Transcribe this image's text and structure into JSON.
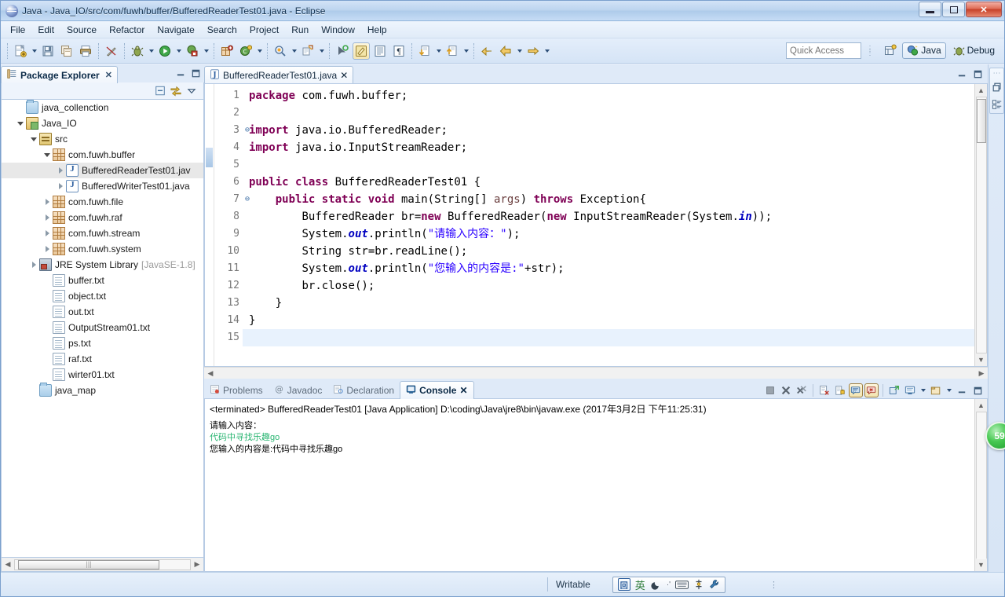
{
  "window": {
    "title": "Java - Java_IO/src/com/fuwh/buffer/BufferedReaderTest01.java - Eclipse",
    "app_icon": "eclipse-icon",
    "minimize_label": "",
    "maximize_label": "",
    "close_label": "✕"
  },
  "menubar": {
    "items": [
      {
        "label": "File"
      },
      {
        "label": "Edit"
      },
      {
        "label": "Source"
      },
      {
        "label": "Refactor"
      },
      {
        "label": "Navigate"
      },
      {
        "label": "Search"
      },
      {
        "label": "Project"
      },
      {
        "label": "Run"
      },
      {
        "label": "Window"
      },
      {
        "label": "Help"
      }
    ]
  },
  "toolbar": {
    "quick_access_placeholder": "Quick Access",
    "quick_access_value": "",
    "buttons": [
      {
        "name": "new-wizard-icon",
        "glyph": "📄"
      },
      {
        "name": "save-icon",
        "glyph": "💾"
      },
      {
        "name": "save-all-icon",
        "glyph": "🗇"
      },
      {
        "name": "print-icon",
        "glyph": "🖨"
      },
      {
        "name": "toggle-mark-occurrences-icon",
        "glyph": "✎"
      },
      {
        "name": "debug-icon",
        "glyph": "🐞"
      },
      {
        "name": "run-icon",
        "glyph": "▶"
      },
      {
        "name": "external-tools-icon",
        "glyph": "🧰"
      },
      {
        "name": "new-java-package-icon",
        "glyph": "📦"
      },
      {
        "name": "new-java-class-icon",
        "glyph": "Ⓒ"
      },
      {
        "name": "open-type-icon",
        "glyph": "🔍"
      },
      {
        "name": "search-icon",
        "glyph": "🔎"
      },
      {
        "name": "next-annotation-icon",
        "glyph": "➤"
      },
      {
        "name": "toggle-block-selection-icon",
        "glyph": "✏"
      },
      {
        "name": "show-whitespace-icon",
        "glyph": "▤"
      },
      {
        "name": "toggle-mark-icon",
        "glyph": "¶"
      },
      {
        "name": "previous-edit-icon",
        "glyph": "↧"
      },
      {
        "name": "next-edit-icon",
        "glyph": "↥"
      },
      {
        "name": "back-icon",
        "glyph": "⬅"
      },
      {
        "name": "forward-icon",
        "glyph": "➡"
      }
    ],
    "perspective_open_label": "",
    "perspectives": [
      {
        "label": "Java",
        "active": true
      },
      {
        "label": "Debug",
        "active": false
      }
    ]
  },
  "package_explorer": {
    "tab_label": "Package Explorer",
    "tab_close": "✕",
    "collapse_all_label": "",
    "link_with_editor_label": "",
    "view_menu_label": "",
    "tree": [
      {
        "indent": 1,
        "twisty": "none",
        "icon": "folder",
        "label": "java_collenction",
        "selected": false
      },
      {
        "indent": 1,
        "twisty": "expanded",
        "icon": "project",
        "label": "Java_IO",
        "selected": false
      },
      {
        "indent": 2,
        "twisty": "expanded",
        "icon": "src",
        "label": "src",
        "selected": false
      },
      {
        "indent": 3,
        "twisty": "expanded",
        "icon": "package",
        "label": "com.fuwh.buffer",
        "selected": false
      },
      {
        "indent": 4,
        "twisty": "collapsed",
        "icon": "java",
        "label": "BufferedReaderTest01.jav",
        "selected": true
      },
      {
        "indent": 4,
        "twisty": "collapsed",
        "icon": "java",
        "label": "BufferedWriterTest01.java",
        "selected": false
      },
      {
        "indent": 3,
        "twisty": "collapsed",
        "icon": "package",
        "label": "com.fuwh.file",
        "selected": false
      },
      {
        "indent": 3,
        "twisty": "collapsed",
        "icon": "package",
        "label": "com.fuwh.raf",
        "selected": false
      },
      {
        "indent": 3,
        "twisty": "collapsed",
        "icon": "package",
        "label": "com.fuwh.stream",
        "selected": false
      },
      {
        "indent": 3,
        "twisty": "collapsed",
        "icon": "package",
        "label": "com.fuwh.system",
        "selected": false
      },
      {
        "indent": 2,
        "twisty": "collapsed",
        "icon": "jre",
        "label": "JRE System Library",
        "suffix": "[JavaSE-1.8]",
        "selected": false
      },
      {
        "indent": 3,
        "twisty": "none",
        "icon": "file",
        "label": "buffer.txt",
        "selected": false
      },
      {
        "indent": 3,
        "twisty": "none",
        "icon": "file",
        "label": "object.txt",
        "selected": false
      },
      {
        "indent": 3,
        "twisty": "none",
        "icon": "file",
        "label": "out.txt",
        "selected": false
      },
      {
        "indent": 3,
        "twisty": "none",
        "icon": "file",
        "label": "OutputStream01.txt",
        "selected": false
      },
      {
        "indent": 3,
        "twisty": "none",
        "icon": "file",
        "label": "ps.txt",
        "selected": false
      },
      {
        "indent": 3,
        "twisty": "none",
        "icon": "file",
        "label": "raf.txt",
        "selected": false
      },
      {
        "indent": 3,
        "twisty": "none",
        "icon": "file",
        "label": "wirter01.txt",
        "selected": false
      },
      {
        "indent": 2,
        "twisty": "none",
        "icon": "folder",
        "label": "java_map",
        "selected": false
      }
    ]
  },
  "editor": {
    "tab_label": "BufferedReaderTest01.java",
    "tab_close": "✕",
    "tab_icon": "java-file-icon",
    "current_line": 15,
    "lines": [
      {
        "n": 1,
        "fold": "",
        "text": "package com.fuwh.buffer;"
      },
      {
        "n": 2,
        "fold": "",
        "text": ""
      },
      {
        "n": 3,
        "fold": "⊖",
        "text": "import java.io.BufferedReader;"
      },
      {
        "n": 4,
        "fold": "",
        "text": "import java.io.InputStreamReader;"
      },
      {
        "n": 5,
        "fold": "",
        "text": ""
      },
      {
        "n": 6,
        "fold": "",
        "text": "public class BufferedReaderTest01 {"
      },
      {
        "n": 7,
        "fold": "⊖",
        "text": "    public static void main(String[] args) throws Exception{"
      },
      {
        "n": 8,
        "fold": "",
        "text": "        BufferedReader br=new BufferedReader(new InputStreamReader(System.in));"
      },
      {
        "n": 9,
        "fold": "",
        "text": "        System.out.println(\"请输入内容：\");"
      },
      {
        "n": 10,
        "fold": "",
        "text": "        String str=br.readLine();"
      },
      {
        "n": 11,
        "fold": "",
        "text": "        System.out.println(\"您输入的内容是:\"+str);"
      },
      {
        "n": 12,
        "fold": "",
        "text": "        br.close();"
      },
      {
        "n": 13,
        "fold": "",
        "text": "    }"
      },
      {
        "n": 14,
        "fold": "",
        "text": "}"
      },
      {
        "n": 15,
        "fold": "",
        "text": ""
      }
    ]
  },
  "console_view": {
    "tabs": [
      {
        "label": "Problems",
        "icon": "problems-icon",
        "active": false
      },
      {
        "label": "Javadoc",
        "icon": "javadoc-icon",
        "active": false
      },
      {
        "label": "Declaration",
        "icon": "declaration-icon",
        "active": false
      },
      {
        "label": "Console",
        "icon": "console-icon",
        "active": true,
        "close": "✕"
      }
    ],
    "tools": [
      {
        "name": "terminate-icon",
        "glyph": "■",
        "on": false
      },
      {
        "name": "remove-launch-icon",
        "glyph": "✖",
        "on": false
      },
      {
        "name": "remove-all-launches-icon",
        "glyph": "✖",
        "on": false
      },
      {
        "name": "clear-console-icon",
        "glyph": "🗋",
        "on": false
      },
      {
        "name": "scroll-lock-icon",
        "glyph": "🔒",
        "on": false
      },
      {
        "name": "show-console-on-output-icon",
        "glyph": "🗨",
        "on": true
      },
      {
        "name": "show-console-on-error-icon",
        "glyph": "🗯",
        "on": true
      },
      {
        "name": "pin-console-icon",
        "glyph": "📌",
        "on": false
      },
      {
        "name": "display-selected-console-icon",
        "glyph": "🖥",
        "on": false
      },
      {
        "name": "open-console-icon",
        "glyph": "🗔",
        "on": false
      },
      {
        "name": "minimize-icon",
        "glyph": "▁",
        "on": false
      },
      {
        "name": "maximize-icon",
        "glyph": "▢",
        "on": false
      }
    ],
    "launch_header": "<terminated> BufferedReaderTest01 [Java Application] D:\\coding\\Java\\jre8\\bin\\javaw.exe (2017年3月2日 下午11:25:31)",
    "output": [
      {
        "text": "请输入内容：",
        "kind": "stdout"
      },
      {
        "text": "代码中寻找乐趣go",
        "kind": "stdin"
      },
      {
        "text": "您输入的内容是:代码中寻找乐趣go",
        "kind": "stdout"
      }
    ]
  },
  "right_bar": {
    "buttons": [
      {
        "name": "restore-icon",
        "glyph": "🗗"
      },
      {
        "name": "outline-view-icon",
        "glyph": "▤"
      }
    ],
    "progress_orb": "59"
  },
  "statusbar": {
    "writable_label": "Writable",
    "ime": {
      "logo": "中",
      "mode_label": "英",
      "items": [
        {
          "name": "ime-logo-icon",
          "glyph": "回"
        },
        {
          "name": "ime-language-label",
          "glyph": "英"
        },
        {
          "name": "ime-punctuation-icon",
          "glyph": "🌙"
        },
        {
          "name": "ime-fullwidth-icon",
          "glyph": "·'"
        },
        {
          "name": "ime-softkeyboard-icon",
          "glyph": "⌨"
        },
        {
          "name": "ime-toolbox-icon",
          "glyph": "⚙"
        },
        {
          "name": "ime-settings-icon",
          "glyph": "🔧"
        }
      ]
    }
  },
  "colors": {
    "keyword": "#7f0055",
    "string": "#2a00ff",
    "field": "#0000c0",
    "accent": "#2bb673",
    "chrome": "#dfeaf8"
  }
}
